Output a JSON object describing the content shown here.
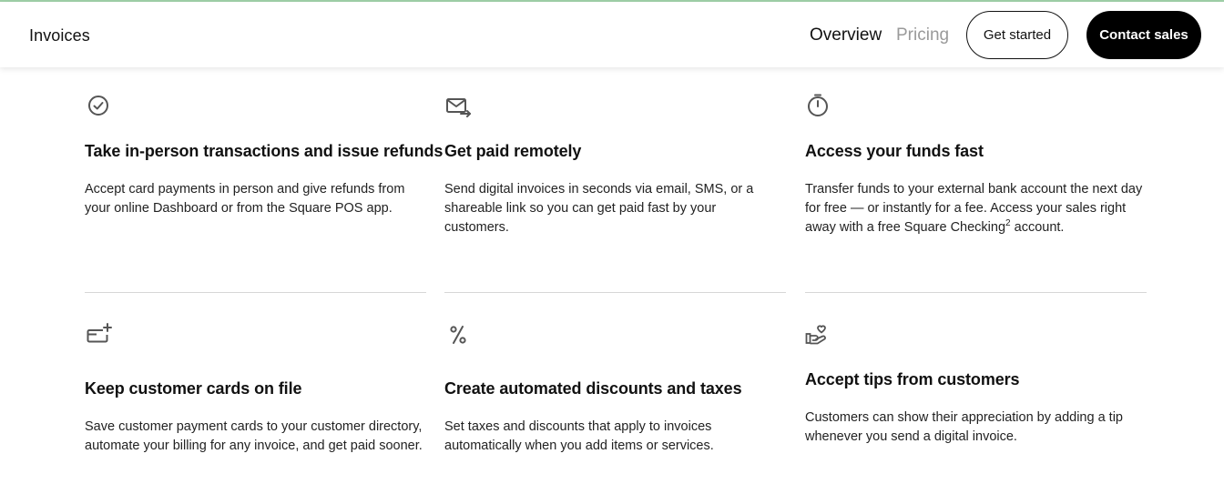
{
  "header": {
    "brand": "Invoices",
    "nav": {
      "overview": "Overview",
      "pricing": "Pricing"
    },
    "get_started": "Get started",
    "contact_sales": "Contact sales"
  },
  "features": [
    {
      "icon": "checkmark-circle-icon",
      "title": "Take in-person transactions and issue refunds",
      "desc": "Accept card payments in person and give refunds from your online Dashboard or from the Square POS app."
    },
    {
      "icon": "envelope-arrow-icon",
      "title": "Get paid remotely",
      "desc": "Send digital invoices in seconds via email, SMS, or a shareable link so you can get paid fast by your customers."
    },
    {
      "icon": "stopwatch-icon",
      "title": "Access your funds fast",
      "desc_before": "Transfer funds to your external bank account the next day for free — or instantly for a fee. Access your sales right away with a free Square Checking",
      "desc_sup": "2",
      "desc_after": " account."
    },
    {
      "icon": "card-plus-icon",
      "title": "Keep customer cards on file",
      "desc": "Save customer payment cards to your customer directory, automate your billing for any invoice, and get paid sooner."
    },
    {
      "icon": "percent-icon",
      "title": "Create automated discounts and taxes",
      "desc": "Set taxes and discounts that apply to invoices automatically when you add items or services."
    },
    {
      "icon": "hand-heart-icon",
      "title": "Accept tips from customers",
      "desc": "Customers can show their appreciation by adding a tip whenever you send a digital invoice."
    }
  ]
}
